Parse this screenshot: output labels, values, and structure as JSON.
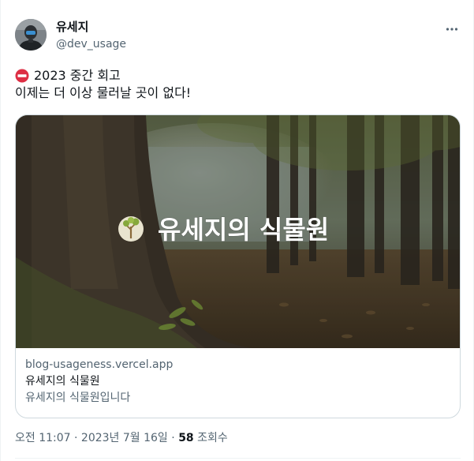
{
  "author": {
    "display_name": "유세지",
    "handle": "@dev_usage"
  },
  "tweet": {
    "line1": "2023 중간 회고",
    "line2": "이제는 더 이상 물러날 곳이 없다!",
    "leading_icon": "no-entry-icon"
  },
  "card": {
    "image_overlay_text": "유세지의 식물원",
    "domain": "blog-usageness.vercel.app",
    "title": "유세지의 식물원",
    "description": "유세지의 식물원입니다"
  },
  "meta": {
    "time": "오전 11:07",
    "separator": " · ",
    "date": "2023년 7월 16일",
    "views_count": "58",
    "views_label": " 조회수"
  },
  "colors": {
    "primary_text": "#0f1419",
    "secondary_text": "#536471",
    "border": "#cfd9de",
    "no_entry_red": "#f4212e"
  }
}
